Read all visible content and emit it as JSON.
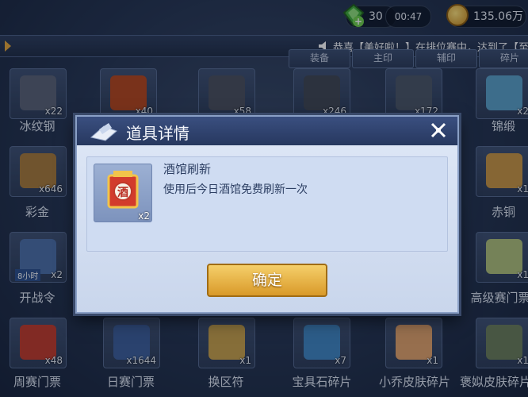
{
  "status": {
    "gems": "30",
    "timer": "00:47",
    "coins": "135.06万"
  },
  "announcement": {
    "text": "恭喜【美好啦！】在排位赛中，达到了【至"
  },
  "tabs": [
    "装备",
    "主印",
    "辅印",
    "碎片"
  ],
  "grid": {
    "row1": [
      {
        "count": "x22",
        "color": "#5a6275"
      },
      {
        "count": "x40",
        "color": "#b5461c"
      },
      {
        "count": "x58",
        "color": "#4a4f5c"
      },
      {
        "count": "x246",
        "color": "#3f4552"
      },
      {
        "count": "x172",
        "color": "#4b5566"
      },
      {
        "count": "x2",
        "color": "#5aa0c8"
      }
    ],
    "row1_names": [
      "冰纹钢",
      "",
      "",
      "",
      "",
      "锦缎"
    ],
    "row2": [
      {
        "count": "x646",
        "color": "#a87a3a"
      },
      {
        "count": "x1",
        "color": "#c99642"
      }
    ],
    "row2_names": [
      "彩金",
      "赤铜"
    ],
    "row3": [
      {
        "count": "x2",
        "color": "#4c6fa8",
        "badge": "8小时"
      },
      {
        "count": "x1",
        "color": "#b0c07a"
      }
    ],
    "row3_names": [
      "开战令",
      "高级赛门票"
    ],
    "row4": [
      {
        "count": "x48",
        "color": "#c23a2a"
      },
      {
        "count": "x1644",
        "color": "#3c5f9c"
      },
      {
        "count": "x1",
        "color": "#c9a24a"
      },
      {
        "count": "x7",
        "color": "#3f86c4"
      },
      {
        "count": "x1",
        "color": "#e3a36a"
      },
      {
        "count": "x1",
        "color": "#6b7d5a"
      }
    ],
    "row4_names": [
      "周赛门票",
      "日赛门票",
      "换区符",
      "宝具石碎片",
      "小乔皮肤碎片",
      "褒姒皮肤碎片"
    ]
  },
  "dialog": {
    "title": "道具详情",
    "item_name": "酒馆刷新",
    "item_desc": "使用后今日酒馆免费刷新一次",
    "item_count": "x2",
    "item_glyph": "酒",
    "confirm_label": "确定"
  }
}
